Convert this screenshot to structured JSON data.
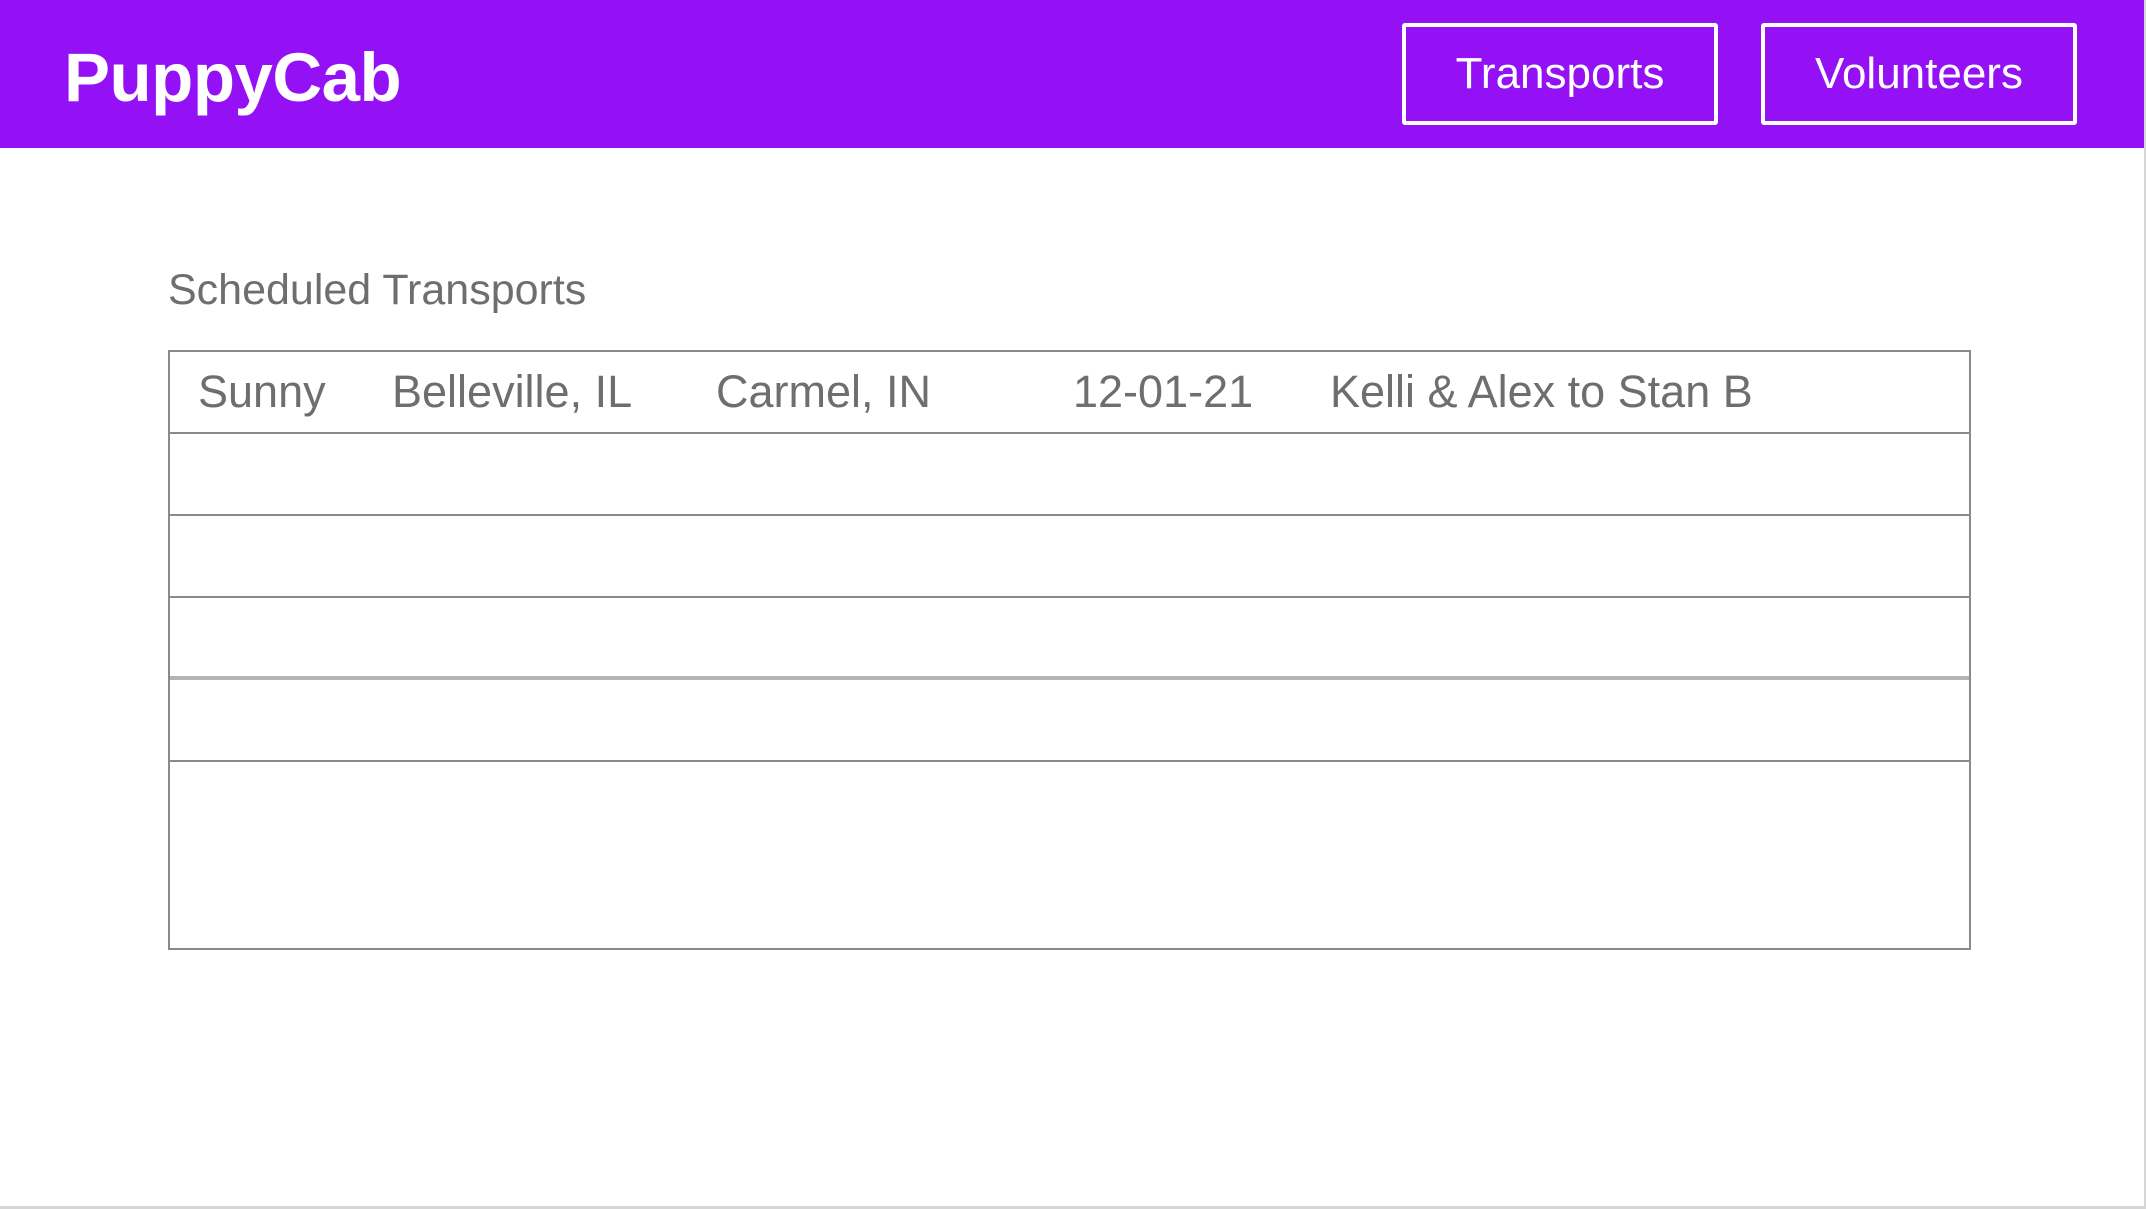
{
  "header": {
    "brand": "PuppyCab",
    "nav": {
      "transports_label": "Transports",
      "volunteers_label": "Volunteers"
    },
    "accent_color": "#9411f5"
  },
  "main": {
    "section_title": "Scheduled Transports",
    "transports": [
      {
        "dog": "Sunny",
        "from": "Belleville, IL",
        "to": "Carmel, IN",
        "date": "12-01-21",
        "drivers": "Kelli & Alex to Stan B"
      }
    ]
  }
}
